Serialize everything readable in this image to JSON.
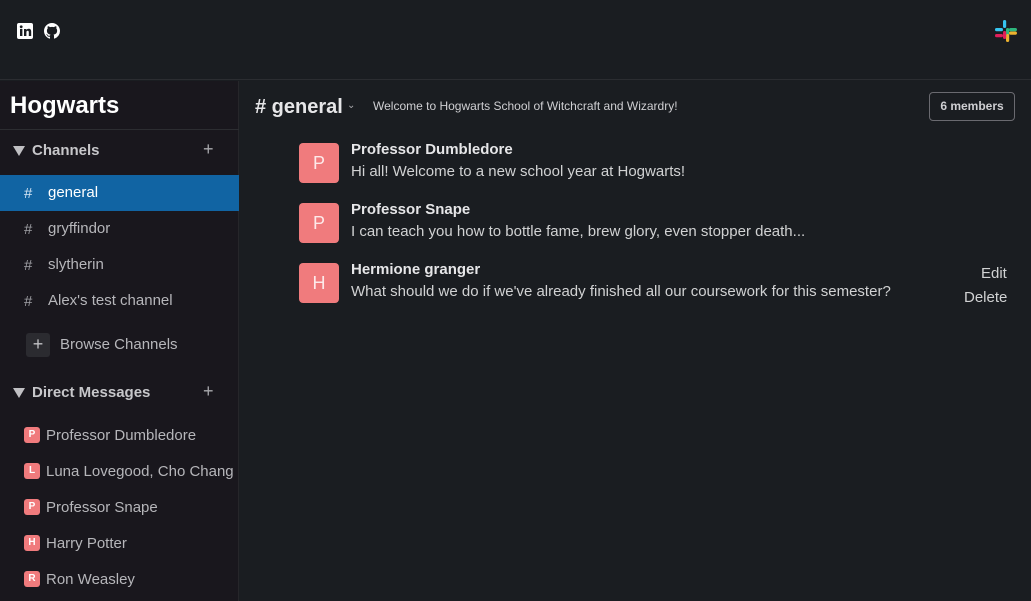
{
  "topbar": {
    "icons": [
      "linkedin-icon",
      "github-icon"
    ],
    "logo": "slack-logo",
    "logo_colors": [
      "#36c5f0",
      "#2eb67d",
      "#ecb22e",
      "#e01e5a"
    ]
  },
  "sidebar": {
    "workspace": "Hogwarts",
    "channels_section": {
      "label": "Channels",
      "add": "+"
    },
    "channels": [
      {
        "hash": "#",
        "name": "general",
        "active": true
      },
      {
        "hash": "#",
        "name": "gryffindor",
        "active": false
      },
      {
        "hash": "#",
        "name": "slytherin",
        "active": false
      },
      {
        "hash": "#",
        "name": "Alex's test channel",
        "active": false
      }
    ],
    "browse": {
      "icon": "+",
      "label": "Browse Channels"
    },
    "dm_section": {
      "label": "Direct Messages",
      "add": "+"
    },
    "dms": [
      {
        "initial": "P",
        "name": "Professor Dumbledore"
      },
      {
        "initial": "L",
        "name": "Luna Lovegood, Cho Chang"
      },
      {
        "initial": "P",
        "name": "Professor Snape"
      },
      {
        "initial": "H",
        "name": "Harry Potter"
      },
      {
        "initial": "R",
        "name": "Ron Weasley"
      }
    ]
  },
  "channel": {
    "title": "# general",
    "chevron": "⌄",
    "topic": "Welcome to Hogwarts School of Witchcraft and Wizardry!",
    "members": "6 members"
  },
  "messages": [
    {
      "initial": "P",
      "author": "Professor Dumbledore",
      "text": "Hi all! Welcome to a new school year at Hogwarts!"
    },
    {
      "initial": "P",
      "author": "Professor Snape",
      "text": "I can teach you how to bottle fame, brew glory, even stopper death..."
    },
    {
      "initial": "H",
      "author": "Hermione granger",
      "text": "What should we do if we've already finished all our coursework for this semester?",
      "edit": "Edit",
      "delete": "Delete"
    }
  ],
  "colors": {
    "background": "#1a1d21",
    "sidebar": "#19171d",
    "active_channel": "#1164a3",
    "avatar": "#f07b7d"
  }
}
